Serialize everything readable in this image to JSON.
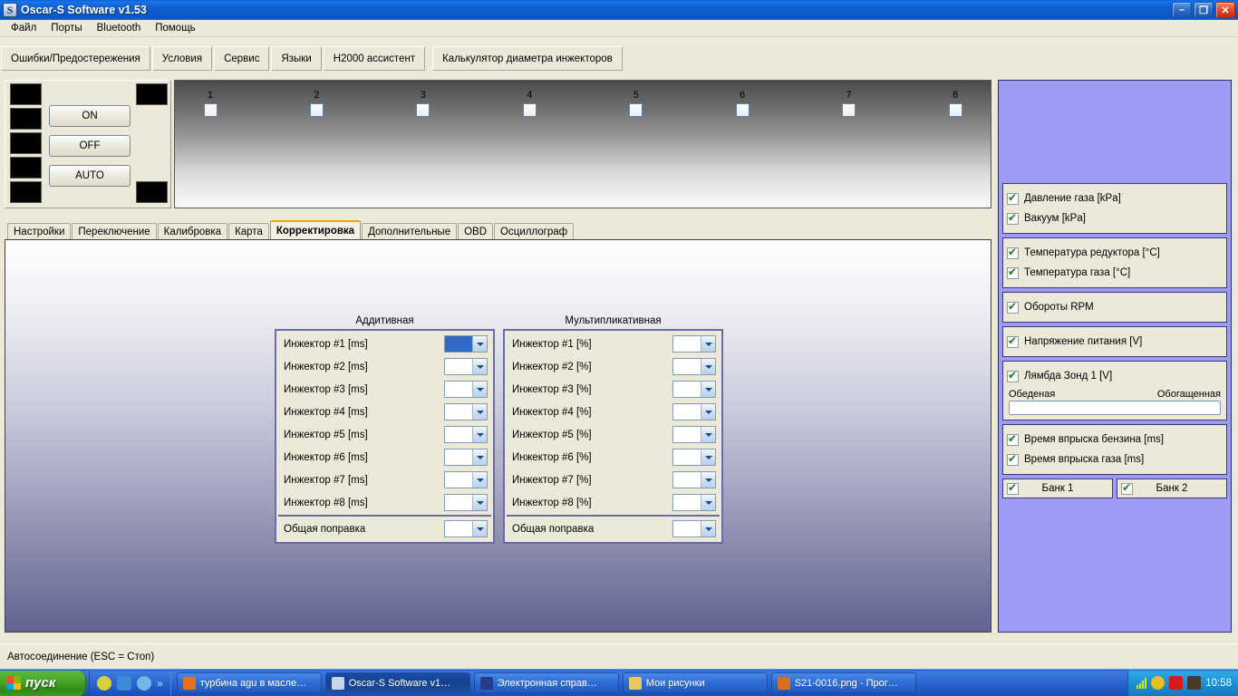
{
  "window": {
    "title": "Oscar-S Software v1.53",
    "icon": "app-icon-s",
    "minimize": "–",
    "restore": "❐",
    "close": "✕"
  },
  "menubar": {
    "items": [
      {
        "label": "Файл"
      },
      {
        "label": "Порты"
      },
      {
        "label": "Bluetooth"
      },
      {
        "label": "Помощь"
      }
    ]
  },
  "toolbar_tabs": {
    "items": [
      {
        "label": "Ошибки/Предостережения"
      },
      {
        "label": "Условия"
      },
      {
        "label": "Сервис"
      },
      {
        "label": "Языки"
      },
      {
        "label": "H2000 ассистент"
      },
      {
        "label": "Калькулятор диаметра инжекторов"
      }
    ]
  },
  "mode_panel": {
    "buttons": [
      {
        "label": "ON"
      },
      {
        "label": "OFF"
      },
      {
        "label": "AUTO"
      }
    ],
    "led_count_left": 5,
    "led_count_right": 2
  },
  "injector_strip": {
    "labels": [
      "1",
      "2",
      "3",
      "4",
      "5",
      "6",
      "7",
      "8"
    ]
  },
  "main_tabs": {
    "active": "Корректировка",
    "items": [
      {
        "label": "Настройки",
        "active": false
      },
      {
        "label": "Переключение",
        "active": false
      },
      {
        "label": "Калибровка",
        "active": false
      },
      {
        "label": "Карта",
        "active": false
      },
      {
        "label": "Корректировка",
        "active": true
      },
      {
        "label": "Дополнительные",
        "active": false
      },
      {
        "label": "OBD",
        "active": false
      },
      {
        "label": "Осциллограф",
        "active": false
      }
    ]
  },
  "correction": {
    "additive": {
      "caption": "Аддитивная",
      "rows": [
        {
          "label": "Инжектор #1 [ms]",
          "value": "",
          "selected": true
        },
        {
          "label": "Инжектор #2 [ms]",
          "value": "",
          "selected": false
        },
        {
          "label": "Инжектор #3 [ms]",
          "value": "",
          "selected": false
        },
        {
          "label": "Инжектор #4 [ms]",
          "value": "",
          "selected": false
        },
        {
          "label": "Инжектор #5 [ms]",
          "value": "",
          "selected": false
        },
        {
          "label": "Инжектор #6 [ms]",
          "value": "",
          "selected": false
        },
        {
          "label": "Инжектор #7 [ms]",
          "value": "",
          "selected": false
        },
        {
          "label": "Инжектор #8 [ms]",
          "value": "",
          "selected": false
        }
      ],
      "total": {
        "label": "Общая поправка",
        "value": ""
      }
    },
    "multiplicative": {
      "caption": "Мультипликативная",
      "rows": [
        {
          "label": "Инжектор #1 [%]",
          "value": "",
          "selected": false
        },
        {
          "label": "Инжектор #2 [%]",
          "value": "",
          "selected": false
        },
        {
          "label": "Инжектор #3 [%]",
          "value": "",
          "selected": false
        },
        {
          "label": "Инжектор #4 [%]",
          "value": "",
          "selected": false
        },
        {
          "label": "Инжектор #5 [%]",
          "value": "",
          "selected": false
        },
        {
          "label": "Инжектор #6 [%]",
          "value": "",
          "selected": false
        },
        {
          "label": "Инжектор #7 [%]",
          "value": "",
          "selected": false
        },
        {
          "label": "Инжектор #8 [%]",
          "value": "",
          "selected": false
        }
      ],
      "total": {
        "label": "Общая поправка",
        "value": ""
      }
    }
  },
  "sidebar": {
    "group1": [
      {
        "label": "Давление газа  [kPa]",
        "checked": true
      },
      {
        "label": "Вакуум  [kPa]",
        "checked": true
      }
    ],
    "group2": [
      {
        "label": "Температура редуктора  [°C]",
        "checked": true
      },
      {
        "label": "Температура газа  [°C]",
        "checked": true
      }
    ],
    "group3": [
      {
        "label": "Обороты RPM",
        "checked": true
      }
    ],
    "group4": [
      {
        "label": "Напряжение питания [V]",
        "checked": true
      }
    ],
    "lambda": {
      "label": "Лямбда Зонд 1 [V]",
      "checked": true,
      "left_label": "Обеденая",
      "right_label": "Обогащенная",
      "bar_value": 0
    },
    "group5": [
      {
        "label": "Время впрыска бензина [ms]",
        "checked": true
      },
      {
        "label": "Время впрыска газа [ms]",
        "checked": true
      }
    ],
    "banks": [
      {
        "label": "Банк 1",
        "checked": true
      },
      {
        "label": "Банк 2",
        "checked": true
      }
    ]
  },
  "statusbar": {
    "text": "Автосоединение (ESC = Стоп)"
  },
  "taskbar": {
    "start_label": "пуск",
    "quicklaunch": [
      {
        "icon": "opera-icon",
        "color": "#d8cf3a"
      },
      {
        "icon": "triangle-icon",
        "color": "#3a8ad8"
      },
      {
        "icon": "internet-explorer-icon",
        "color": "#6fb8e8"
      }
    ],
    "overflow": "»",
    "tasks": [
      {
        "label": "турбина agu в масле…",
        "icon": "firefox-icon",
        "color": "#e8701a",
        "active": false
      },
      {
        "label": "Oscar-S Software v1…",
        "icon": "app-icon-s",
        "color": "#c8d4e8",
        "active": true
      },
      {
        "label": "Электронная справ…",
        "icon": "help-icon",
        "color": "#2a3a8a",
        "active": false
      },
      {
        "label": "Мои рисунки",
        "icon": "folder-pictures-icon",
        "color": "#e8c860",
        "active": false
      },
      {
        "label": "S21-0016.png - Прог…",
        "icon": "image-viewer-icon",
        "color": "#d87020",
        "active": false
      }
    ],
    "tray": [
      {
        "icon": "signal-bars-icon",
        "color": "#d8f000"
      },
      {
        "icon": "update-icon",
        "color": "#e8c020"
      },
      {
        "icon": "avira-icon",
        "color": "#d81a1a"
      },
      {
        "icon": "display-icon",
        "color": "#4a3a2a"
      }
    ],
    "clock": "10:58"
  }
}
